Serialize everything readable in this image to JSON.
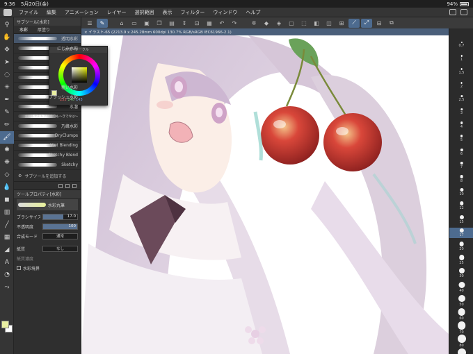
{
  "status": {
    "time": "9:36",
    "date": "5月20日(金)",
    "battery": "94%"
  },
  "menu": [
    "ファイル",
    "編集",
    "アニメーション",
    "レイヤー",
    "選択範囲",
    "表示",
    "フィルター",
    "ウィンドウ",
    "ヘルプ"
  ],
  "subtool": {
    "title": "サブツール[水彩]",
    "tabs": [
      "水彩",
      "厚塗り"
    ],
    "brushes": [
      "透明水彩",
      "にじみ水彩",
      "",
      "",
      "",
      "粗い水彩",
      "スプラッシュ水彩",
      "水溜",
      "主線も水彩も塗り塗りも〜きで今は〜",
      "乃峰水彩",
      "DryClumps",
      "Wet Blending",
      "Sketchy Blend",
      "Sketchy"
    ],
    "selected_index": 0,
    "add_label": "サブツールを追加する"
  },
  "tool_property": {
    "title": "ツールプロパティ[水彩]",
    "preview_name": "水彩丸筆",
    "brush_size_label": "ブラシサイズ",
    "brush_size_value": "17.0",
    "brush_size_fraction": 0.6,
    "opacity_label": "不透明度",
    "opacity_value": "100",
    "opacity_fraction": 1.0,
    "blend_label": "合成モード",
    "blend_value": "通常",
    "paper_label": "紙質",
    "paper_value": "なし",
    "paper_strength_label": "紙質濃度",
    "watercolor_edge_label": "水彩境界"
  },
  "color_popup": {
    "title": "カラーサークル",
    "h": "233",
    "s": "240",
    "v": "143",
    "color": "#e9efa2"
  },
  "canvas_tab": "× イラスト-65 (2213.9 x 245.28mm 600dpi 130.7%  RGB/sRGB IEC61966-2.1)",
  "brush_sizes": [
    "0.7",
    "1",
    "1.5",
    "2",
    "2.5",
    "3",
    "4",
    "5",
    "6",
    "7",
    "8",
    "10",
    "12",
    "15",
    "17",
    "20",
    "25",
    "30",
    "40",
    "50",
    "60",
    "70",
    "80",
    "100"
  ],
  "brush_size_selected": "17",
  "colors": {
    "accent": "#4d6b8f",
    "panel": "#2f2f2f",
    "canvas": "#ffffff"
  }
}
